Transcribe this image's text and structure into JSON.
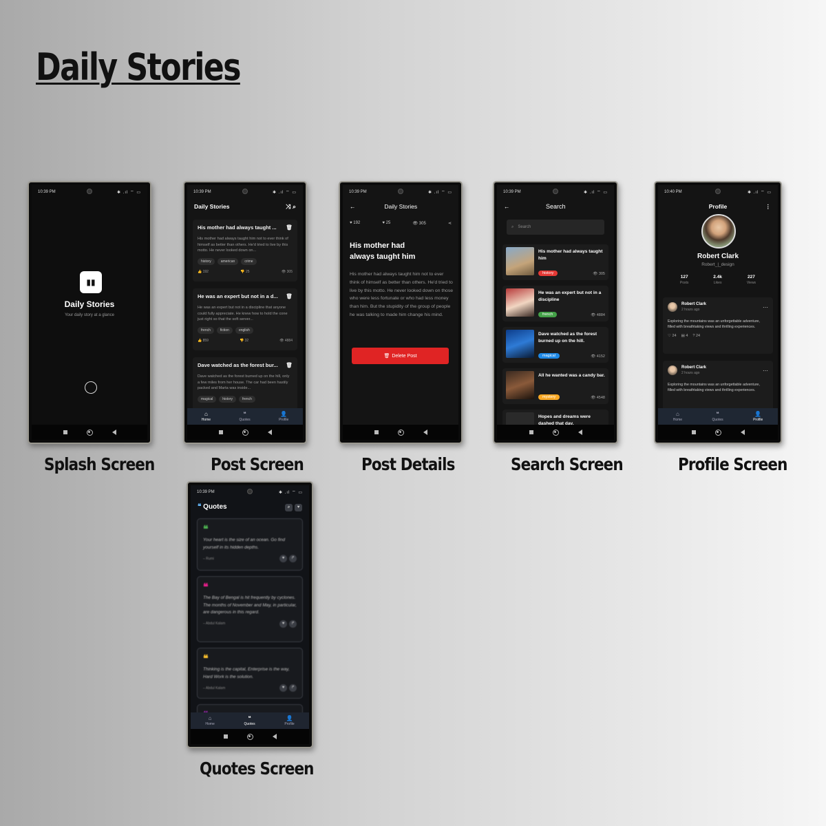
{
  "title": "Daily Stories",
  "captions": {
    "splash": "Splash Screen",
    "post": "Post Screen",
    "details": "Post Details",
    "search": "Search Screen",
    "profile": "Profile Screen",
    "quotes": "Quotes Screen"
  },
  "status": {
    "time1": "10:39 PM",
    "time2": "10:40 PM",
    "icons": "✱ .ıl ⌔ ▭"
  },
  "splash": {
    "app_name": "Daily Stories",
    "tagline": "Your daily story at a glance"
  },
  "feed": {
    "header": "Daily Stories",
    "posts": [
      {
        "title": "His mother had always taught ...",
        "body": "His mother had always taught him not to ever think of himself as better than others. He'd tried to live by this motto. He never looked down on...",
        "tags": [
          "history",
          "american",
          "crime"
        ],
        "likes": "192",
        "dislikes": "25",
        "views": "305"
      },
      {
        "title": "He was an expert but not in a d...",
        "body": "He was an expert but not in a discipline that anyone could fully appreciate. He knew how to hold the cone just right so that the soft server...",
        "tags": [
          "french",
          "fiction",
          "english"
        ],
        "likes": "859",
        "dislikes": "32",
        "views": "4884"
      },
      {
        "title": "Dave watched as the forest bur...",
        "body": "Dave watched as the forest burned up on the hill, only a few miles from her house. The car had been hastily packed and Marta was inside...",
        "tags": [
          "magical",
          "history",
          "french"
        ]
      }
    ],
    "nav": [
      "Home",
      "Quotes",
      "Profile"
    ]
  },
  "details": {
    "header": "Daily Stories",
    "likes": "192",
    "dislikes": "25",
    "views": "305",
    "title": "His mother had always taught him",
    "body": "His mother had always taught him not to ever think of himself as better than others. He'd tried to live by this motto. He never looked down on those who were less fortunate or who had less money than him. But the stupidity of the group of people he was talking to made him change his mind.",
    "delete_label": "Delete Post"
  },
  "search": {
    "header": "Search",
    "placeholder": "Search",
    "results": [
      {
        "title": "His mother had always taught him",
        "tag": "history",
        "tag_color": "#e53935",
        "views": "305"
      },
      {
        "title": "He was an expert but not in a discipline",
        "tag": "french",
        "tag_color": "#43a047",
        "views": "4884"
      },
      {
        "title": "Dave watched as the forest burned up on the hill.",
        "tag": "magical",
        "tag_color": "#1e88e5",
        "views": "4152"
      },
      {
        "title": "All he wanted was a candy bar.",
        "tag": "mystery",
        "tag_color": "#f9a825",
        "views": "4548"
      },
      {
        "title": "Hopes and dreams were dashed that day."
      }
    ]
  },
  "profile": {
    "header": "Profile",
    "name": "Robert Clark",
    "handle": "Robert_|_design",
    "stats": [
      {
        "value": "127",
        "label": "Posts"
      },
      {
        "value": "2.4k",
        "label": "Likes"
      },
      {
        "value": "227",
        "label": "Views"
      }
    ],
    "posts": [
      {
        "author": "Robert Clark",
        "time": "2 hours ago",
        "text": "Exploring the mountains was an unforgettable adventure, filled with breathtaking views and thrilling experiences.",
        "likes": "24",
        "comments": "4",
        "shares": "24"
      },
      {
        "author": "Robert Clark",
        "time": "2 hours ago",
        "text": "Exploring the mountains was an unforgettable adventure, filled with breathtaking views and thrilling experiences."
      }
    ],
    "nav": [
      "Home",
      "Quotes",
      "Profile"
    ]
  },
  "quotes": {
    "header": "Quotes",
    "items": [
      {
        "text": "Your heart is the size of an ocean. Go find yourself in its hidden depths.",
        "author": "– Rumi",
        "color": "#4caf50"
      },
      {
        "text": "The Bay of Bengal is hit frequently by cyclones. The months of November and May, in particular, are dangerous in this regard.",
        "author": "– Abdul Kalam",
        "color": "#e91e8c"
      },
      {
        "text": "Thinking is the capital, Enterprise is the way, Hard Work is the solution.",
        "author": "– Abdul Kalam",
        "color": "#fbc02d"
      }
    ],
    "nav": [
      "Home",
      "Quotes",
      "Profile"
    ]
  },
  "colors": {
    "accent_red": "#e02424",
    "nav_bg": "#1f2733",
    "screen_bg": "#141414"
  }
}
